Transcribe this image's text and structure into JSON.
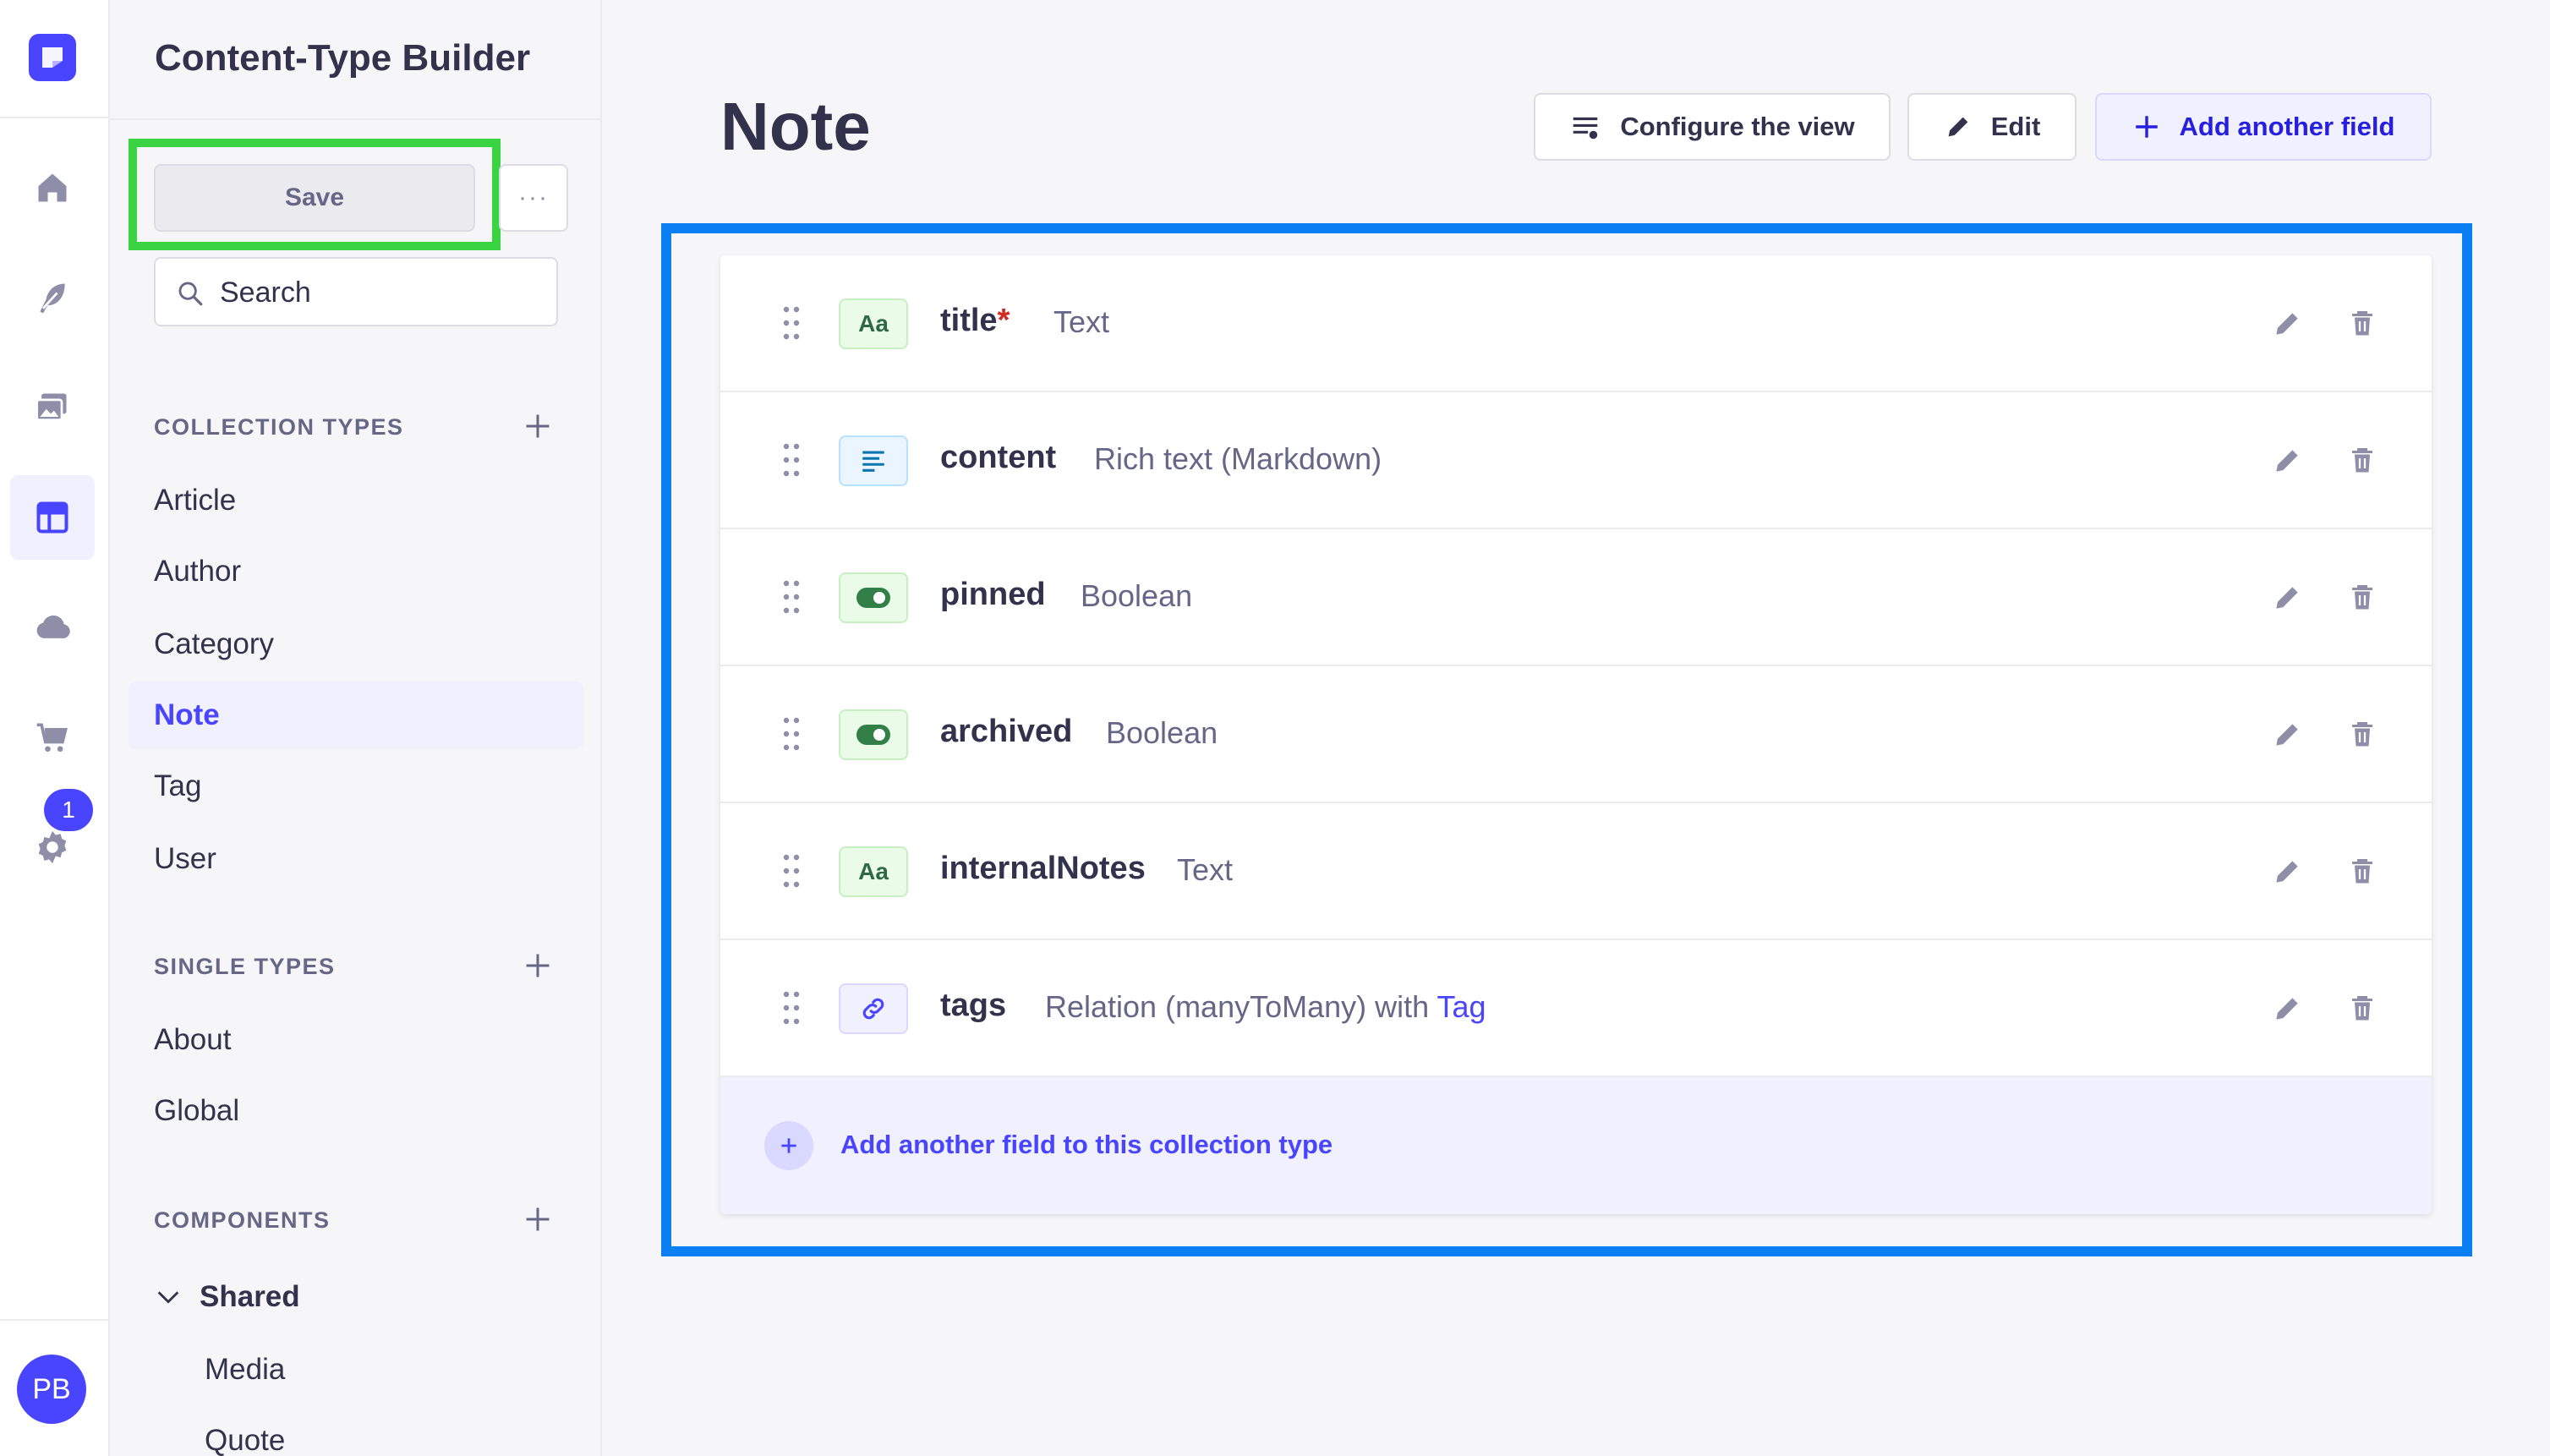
{
  "app": {
    "avatar_initials": "PB",
    "notification_count": "1",
    "accent_color": "#4945ff",
    "rail_items": [
      "home-icon",
      "feather-icon",
      "media-icon",
      "layout-icon",
      "cloud-icon",
      "cart-icon",
      "gear-icon"
    ]
  },
  "sidebar": {
    "title": "Content-Type Builder",
    "save_label": "Save",
    "more_label": "···",
    "search_placeholder": "Search",
    "collection_types_label": "COLLECTION TYPES",
    "collection_types": [
      "Article",
      "Author",
      "Category",
      "Note",
      "Tag",
      "User"
    ],
    "active_item": "Note",
    "single_types_label": "SINGLE TYPES",
    "single_types": [
      "About",
      "Global"
    ],
    "components_label": "COMPONENTS",
    "component_group": "Shared",
    "components": [
      "Media",
      "Quote"
    ]
  },
  "main": {
    "title": "Note",
    "configure_label": "Configure the view",
    "edit_label": "Edit",
    "add_field_label": "Add another field",
    "fields": [
      {
        "name": "title",
        "required_mark": "*",
        "type": "Text",
        "icon": "text-icon",
        "tile_text": "Aa"
      },
      {
        "name": "content",
        "type": "Rich text (Markdown)",
        "icon": "rich-text-icon"
      },
      {
        "name": "pinned",
        "type": "Boolean",
        "icon": "toggle-icon"
      },
      {
        "name": "archived",
        "type": "Boolean",
        "icon": "toggle-icon"
      },
      {
        "name": "internalNotes",
        "type": "Text",
        "icon": "text-icon",
        "tile_text": "Aa"
      },
      {
        "name": "tags",
        "type": "Relation (manyToMany) with",
        "type_link": "Tag",
        "icon": "relation-icon"
      }
    ],
    "add_footer_label": "Add another field to this collection type"
  }
}
